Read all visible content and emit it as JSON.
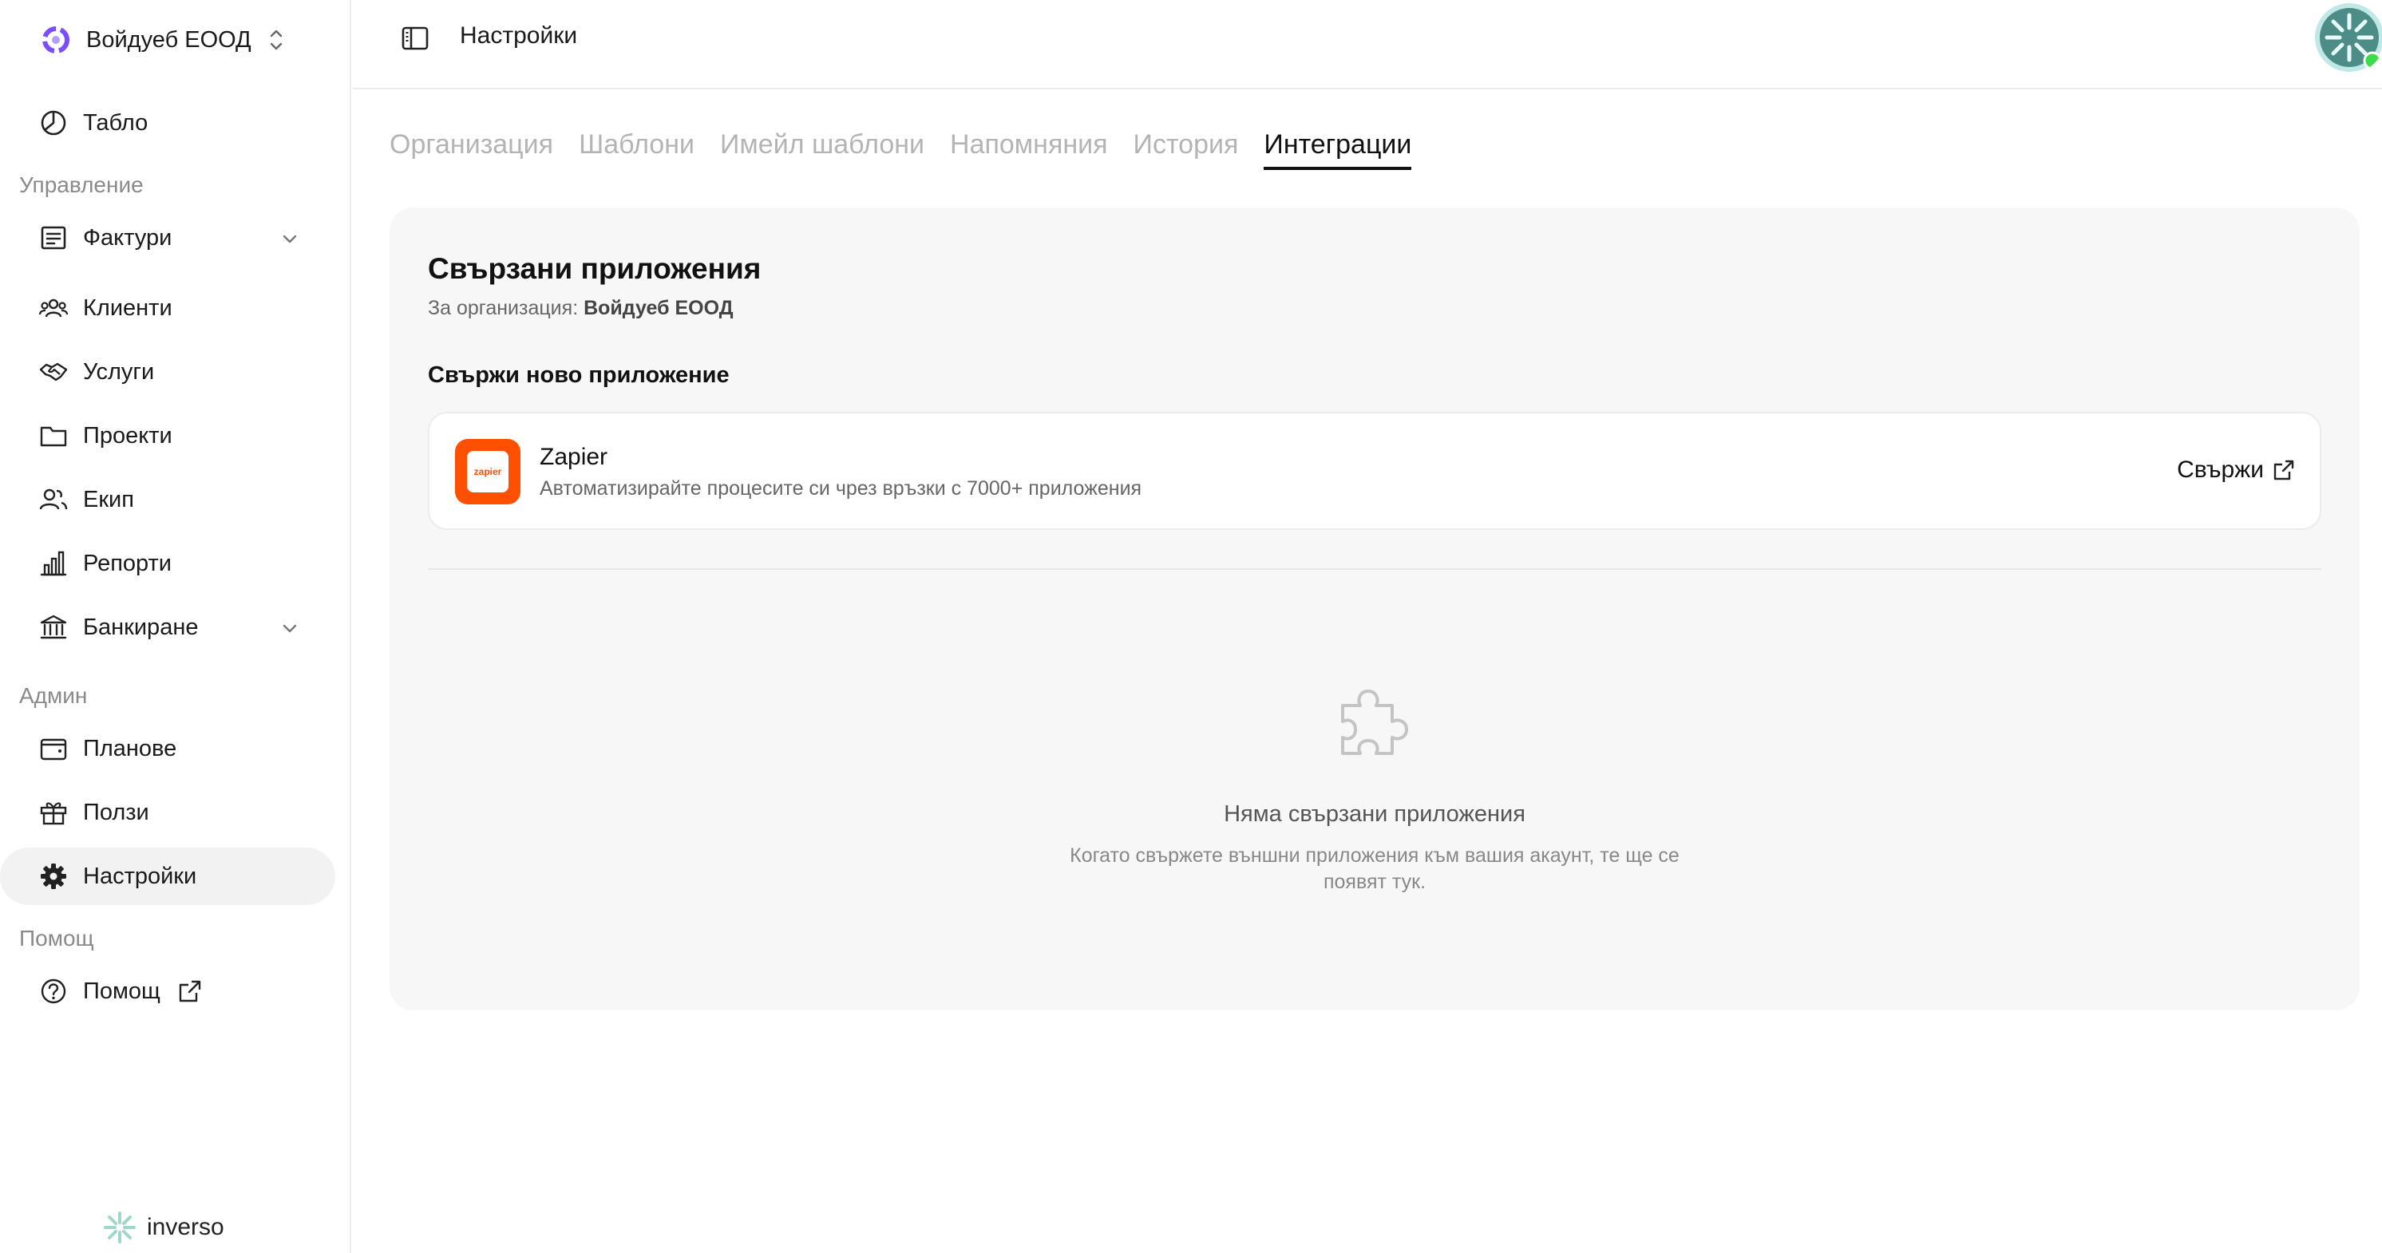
{
  "organization": {
    "name": "Войдуеб ЕООД"
  },
  "sidebar": {
    "top_item": {
      "label": "Табло",
      "icon": "pie-chart-icon"
    },
    "sections": [
      {
        "title": "Управление"
      },
      {
        "title": "Админ"
      },
      {
        "title": "Помощ"
      }
    ],
    "items": [
      {
        "label": "Фактури",
        "icon": "invoice-icon"
      },
      {
        "label": "Клиенти",
        "icon": "clients-icon"
      },
      {
        "label": "Услуги",
        "icon": "handshake-icon"
      },
      {
        "label": "Проекти",
        "icon": "folder-icon"
      },
      {
        "label": "Екип",
        "icon": "team-icon"
      },
      {
        "label": "Репорти",
        "icon": "bar-chart-icon"
      },
      {
        "label": "Банкиране",
        "icon": "bank-icon"
      },
      {
        "label": "Планове",
        "icon": "wallet-icon"
      },
      {
        "label": "Ползи",
        "icon": "gift-icon"
      },
      {
        "label": "Настройки",
        "icon": "gear-icon"
      },
      {
        "label": "Помощ",
        "icon": "help-icon"
      }
    ],
    "brand": "inverso"
  },
  "header": {
    "title": "Настройки"
  },
  "tabs": [
    {
      "label": "Организация"
    },
    {
      "label": "Шаблони"
    },
    {
      "label": "Имейл шаблони"
    },
    {
      "label": "Напомняния"
    },
    {
      "label": "История"
    },
    {
      "label": "Интеграции"
    }
  ],
  "active_tab": "Интеграции",
  "integrations": {
    "title": "Свързани приложения",
    "subtitle_prefix": "За организация:",
    "subtitle_org": "Войдуеб ЕООД",
    "connect_heading": "Свържи ново приложение",
    "apps": [
      {
        "name": "Zapier",
        "logo_text": "zapier",
        "description": "Автоматизирайте процесите си чрез връзки с 7000+ приложения",
        "action": "Свържи"
      }
    ],
    "empty_title": "Няма свързани приложения",
    "empty_text": "Когато свържете външни приложения към вашия акаунт, те ще се появят тук."
  },
  "colors": {
    "zapier": "#ff4f00",
    "accent": "#7c4dff",
    "online": "#3ddc4b"
  }
}
